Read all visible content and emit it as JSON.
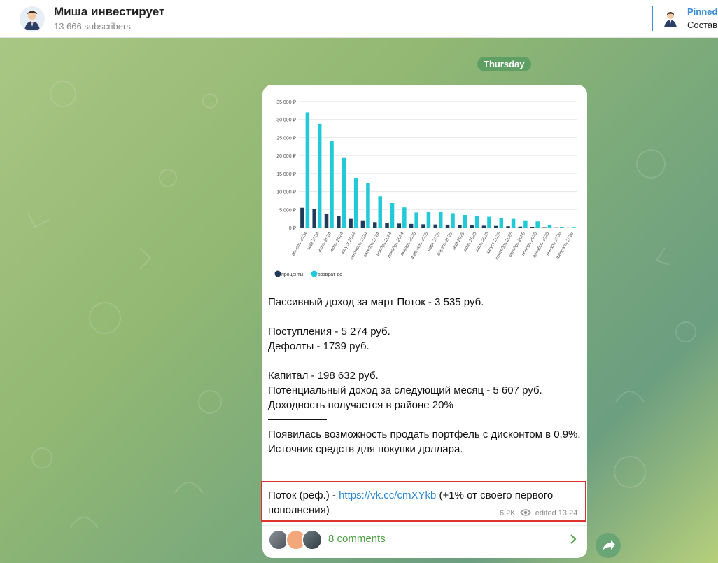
{
  "header": {
    "title": "Миша инвестирует",
    "subscribers": "13 666 subscribers",
    "pinned_title": "Pinned",
    "pinned_text": "Составила"
  },
  "chat": {
    "date_label": "Thursday"
  },
  "message": {
    "lines": [
      "Пассивный доход за март Поток - 3 535 руб.",
      "Поступления - 5 274 руб.",
      "Дефолты - 1739 руб.",
      "Капитал - 198 632 руб.",
      "Потенциальный доход за следующий месяц - 5 607 руб.",
      "Доходность получается в районе 20%",
      "Появилась возможность продать портфель с дисконтом в 0,9%.",
      "Источник средств для покупки доллара."
    ],
    "ref_prefix": "Поток (реф.) - ",
    "ref_link": "https://vk.cc/cmXYkb",
    "ref_suffix": " (+1% от своего первого пополнения)",
    "views": "6,2K",
    "edited": "edited 13:24",
    "comments_label": "8 comments"
  },
  "colors": {
    "accent": "#3a8fd8",
    "series_interest": "#1f3a5a",
    "series_return": "#22c9d8",
    "comments": "#4fa145",
    "highlight": "#d9332b"
  },
  "icons": [
    "avatar-icon",
    "eye-icon",
    "chevron-right-icon",
    "share-icon"
  ],
  "chart_data": {
    "type": "bar",
    "categories": [
      "апрель 2024",
      "май 2024",
      "июнь 2024",
      "июль 2024",
      "август 2024",
      "сентябрь 2024",
      "октябрь 2024",
      "ноябрь 2024",
      "декабрь 2024",
      "январь 2025",
      "февраль 2025",
      "март 2025",
      "апрель 2025",
      "май 2025",
      "июнь 2025",
      "июль 2025",
      "август 2025",
      "сентябрь 2025",
      "октябрь 2025",
      "ноябрь 2025",
      "декабрь 2025",
      "январь 2026",
      "февраль 2026"
    ],
    "series": [
      {
        "name": "проценты",
        "values": [
          5500,
          5200,
          3800,
          3200,
          2400,
          2000,
          1500,
          1200,
          1100,
          1000,
          900,
          850,
          800,
          700,
          600,
          500,
          450,
          350,
          250,
          200,
          100,
          50,
          20
        ]
      },
      {
        "name": "возврат дс",
        "values": [
          32000,
          28800,
          24000,
          19500,
          13800,
          12300,
          8700,
          6800,
          5600,
          4200,
          4300,
          4300,
          4000,
          3500,
          3200,
          3000,
          2700,
          2400,
          2000,
          1700,
          800,
          200,
          150
        ]
      }
    ],
    "y_ticks": [
      "35 000 ₽",
      "30 000 ₽",
      "25 000 ₽",
      "20 000 ₽",
      "15 000 ₽",
      "10 000 ₽",
      "5 000 ₽",
      "0 ₽"
    ],
    "ylim": [
      0,
      35000
    ],
    "grid": true,
    "legend": "bottom-left"
  }
}
